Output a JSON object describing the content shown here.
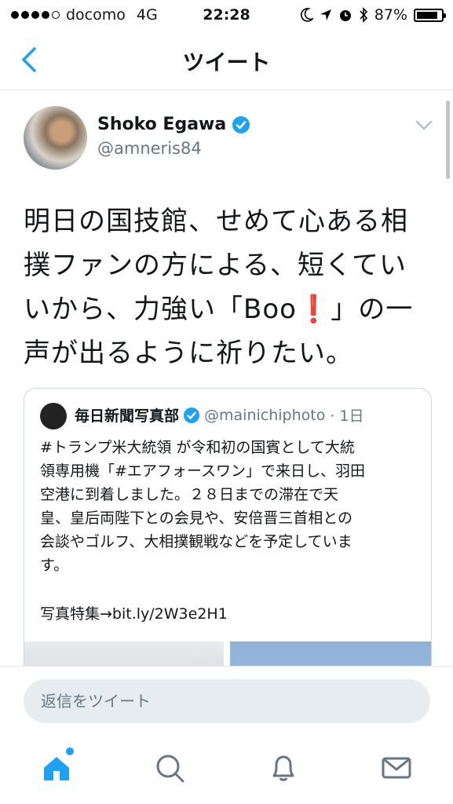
{
  "status_bar": {
    "carrier": "docomo",
    "network": "4G",
    "time": "22:28",
    "battery": "87%",
    "battery_level": 0.87
  },
  "nav": {
    "title": "ツイート"
  },
  "tweet": {
    "author_name": "Shoko Egawa",
    "handle": "@amneris84",
    "text_lines": [
      "明日の国技館、せめて心ある相",
      "撲ファンの方による、短くてい",
      "いから、力強い「Boo",
      "声が出るように祈りたい。"
    ],
    "text_line3_tail": "」の一",
    "exclamation": "❗"
  },
  "quote": {
    "author_name": "毎日新聞写真部",
    "handle": "@mainichiphoto",
    "time": "· 1日",
    "text_lines": [
      "#トランプ米大統領 が令和初の国賓として大統",
      "領専用機「#エアフォースワン」で来日し、羽田",
      "空港に到着しました。２８日までの滞在で天",
      "皇、皇后両陛下との会見や、安倍晋三首相との",
      "会談やゴルフ、大相撲観戦などを予定していま",
      "す。"
    ],
    "link": "写真特集→bit.ly/2W3e2H1"
  },
  "reply": {
    "placeholder": "返信をツイート"
  },
  "tabs": [
    "home-icon",
    "search-icon",
    "bell-icon",
    "mail-icon"
  ],
  "colors": {
    "accent": "#1da1f2",
    "secondary_text": "#657786"
  }
}
